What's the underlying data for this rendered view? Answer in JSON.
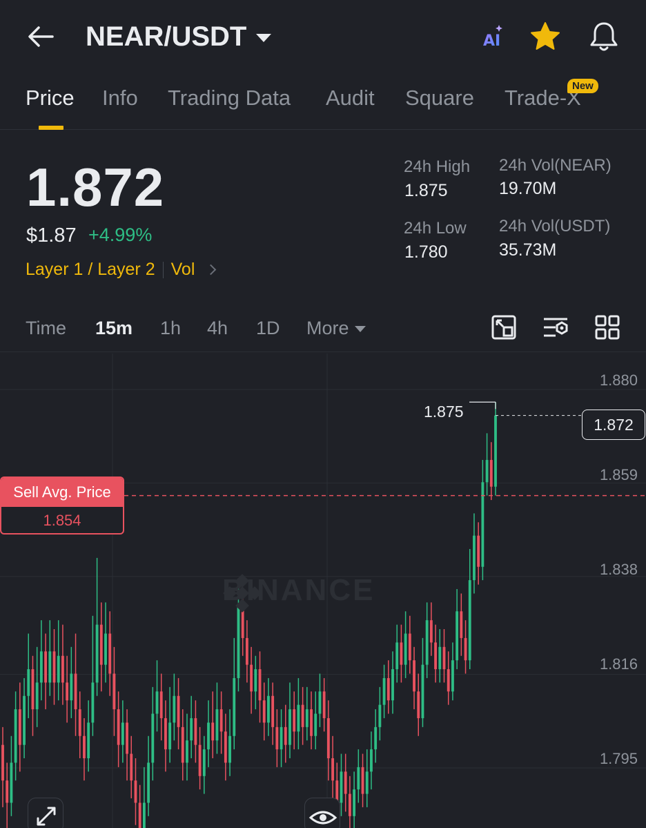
{
  "header": {
    "title": "NEAR/USDT",
    "icons": [
      "back-arrow-icon",
      "ai-icon",
      "star-icon",
      "bell-icon"
    ],
    "star_color": "#f0b90b"
  },
  "tabs": [
    {
      "label": "Price",
      "active": true
    },
    {
      "label": "Info"
    },
    {
      "label": "Trading Data"
    },
    {
      "label": "Audit"
    },
    {
      "label": "Square"
    },
    {
      "label": "Trade-X",
      "badge": "New"
    }
  ],
  "ticker": {
    "last_price": "1.872",
    "usd_price": "$1.87",
    "change_pct": "+4.99%",
    "tag_category": "Layer 1 / Layer 2",
    "tag_vol": "Vol",
    "stats": {
      "high_label": "24h High",
      "high_value": "1.875",
      "low_label": "24h Low",
      "low_value": "1.780",
      "vol_base_label": "24h Vol(NEAR)",
      "vol_base_value": "19.70M",
      "vol_quote_label": "24h Vol(USDT)",
      "vol_quote_value": "35.73M"
    }
  },
  "intervals": {
    "items": [
      "Time",
      "15m",
      "1h",
      "4h",
      "1D",
      "More"
    ],
    "active": "15m",
    "tool_icons": [
      "chart-type-icon",
      "indicator-settings-icon",
      "grid-layout-icon"
    ]
  },
  "chart": {
    "watermark": "BINANCE",
    "axis_labels": [
      "1.880",
      "1.859",
      "1.838",
      "1.816",
      "1.795"
    ],
    "high_marker": "1.875",
    "current_price": "1.872",
    "sell_avg_label": "Sell Avg. Price",
    "sell_avg_value": "1.854",
    "colors": {
      "up": "#2ebd85",
      "down": "#e8525f"
    }
  },
  "chart_data": {
    "type": "candlestick",
    "interval": "15m",
    "y_ticks": [
      1.88,
      1.859,
      1.838,
      1.816,
      1.795
    ],
    "ylim": [
      1.772,
      1.884
    ],
    "candles": [
      [
        1.798,
        1.79,
        1.802,
        1.784
      ],
      [
        1.79,
        1.785,
        1.794,
        1.779
      ],
      [
        1.785,
        1.794,
        1.8,
        1.782
      ],
      [
        1.794,
        1.806,
        1.81,
        1.79
      ],
      [
        1.806,
        1.798,
        1.812,
        1.792
      ],
      [
        1.798,
        1.809,
        1.813,
        1.795
      ],
      [
        1.809,
        1.815,
        1.823,
        1.804
      ],
      [
        1.815,
        1.806,
        1.818,
        1.8
      ],
      [
        1.806,
        1.812,
        1.82,
        1.802
      ],
      [
        1.812,
        1.819,
        1.826,
        1.808
      ],
      [
        1.819,
        1.812,
        1.823,
        1.806
      ],
      [
        1.812,
        1.819,
        1.826,
        1.809
      ],
      [
        1.819,
        1.812,
        1.824,
        1.807
      ],
      [
        1.812,
        1.818,
        1.826,
        1.808
      ],
      [
        1.818,
        1.812,
        1.825,
        1.807
      ],
      [
        1.812,
        1.808,
        1.818,
        1.803
      ],
      [
        1.808,
        1.814,
        1.82,
        1.804
      ],
      [
        1.814,
        1.806,
        1.823,
        1.8
      ],
      [
        1.806,
        1.8,
        1.81,
        1.795
      ],
      [
        1.8,
        1.795,
        1.804,
        1.79
      ],
      [
        1.795,
        1.803,
        1.808,
        1.792
      ],
      [
        1.803,
        1.812,
        1.827,
        1.8
      ],
      [
        1.812,
        1.825,
        1.84,
        1.809
      ],
      [
        1.825,
        1.816,
        1.83,
        1.81
      ],
      [
        1.816,
        1.823,
        1.83,
        1.812
      ],
      [
        1.823,
        1.814,
        1.828,
        1.809
      ],
      [
        1.814,
        1.806,
        1.82,
        1.8
      ],
      [
        1.806,
        1.798,
        1.81,
        1.793
      ],
      [
        1.798,
        1.803,
        1.808,
        1.794
      ],
      [
        1.803,
        1.796,
        1.806,
        1.79
      ],
      [
        1.796,
        1.79,
        1.8,
        1.786
      ],
      [
        1.79,
        1.785,
        1.795,
        1.78
      ],
      [
        1.785,
        1.778,
        1.789,
        1.774
      ],
      [
        1.778,
        1.785,
        1.793,
        1.776
      ],
      [
        1.785,
        1.794,
        1.8,
        1.782
      ],
      [
        1.794,
        1.805,
        1.811,
        1.79
      ],
      [
        1.805,
        1.81,
        1.817,
        1.801
      ],
      [
        1.81,
        1.804,
        1.814,
        1.799
      ],
      [
        1.804,
        1.797,
        1.808,
        1.792
      ],
      [
        1.797,
        1.803,
        1.811,
        1.794
      ],
      [
        1.803,
        1.809,
        1.814,
        1.799
      ],
      [
        1.809,
        1.802,
        1.813,
        1.797
      ],
      [
        1.802,
        1.794,
        1.806,
        1.79
      ],
      [
        1.794,
        1.799,
        1.805,
        1.79
      ],
      [
        1.799,
        1.804,
        1.809,
        1.795
      ],
      [
        1.804,
        1.798,
        1.808,
        1.794
      ],
      [
        1.798,
        1.791,
        1.802,
        1.788
      ],
      [
        1.791,
        1.797,
        1.8,
        1.787
      ],
      [
        1.797,
        1.803,
        1.808,
        1.793
      ],
      [
        1.803,
        1.799,
        1.81,
        1.795
      ],
      [
        1.799,
        1.806,
        1.812,
        1.796
      ],
      [
        1.806,
        1.801,
        1.81,
        1.796
      ],
      [
        1.801,
        1.794,
        1.805,
        1.79
      ],
      [
        1.794,
        1.8,
        1.806,
        1.791
      ],
      [
        1.8,
        1.813,
        1.822,
        1.797
      ],
      [
        1.813,
        1.829,
        1.835,
        1.81
      ],
      [
        1.829,
        1.822,
        1.832,
        1.818
      ],
      [
        1.822,
        1.816,
        1.826,
        1.812
      ],
      [
        1.816,
        1.81,
        1.82,
        1.805
      ],
      [
        1.81,
        1.815,
        1.818,
        1.806
      ],
      [
        1.815,
        1.808,
        1.819,
        1.803
      ],
      [
        1.808,
        1.803,
        1.812,
        1.799
      ],
      [
        1.803,
        1.809,
        1.813,
        1.8
      ],
      [
        1.809,
        1.802,
        1.812,
        1.798
      ],
      [
        1.802,
        1.797,
        1.806,
        1.793
      ],
      [
        1.797,
        1.802,
        1.806,
        1.793
      ],
      [
        1.802,
        1.798,
        1.807,
        1.794
      ],
      [
        1.798,
        1.806,
        1.812,
        1.795
      ],
      [
        1.806,
        1.801,
        1.81,
        1.797
      ],
      [
        1.801,
        1.807,
        1.813,
        1.797
      ],
      [
        1.807,
        1.802,
        1.811,
        1.798
      ],
      [
        1.802,
        1.806,
        1.811,
        1.799
      ],
      [
        1.806,
        1.8,
        1.81,
        1.797
      ],
      [
        1.8,
        1.805,
        1.81,
        1.797
      ],
      [
        1.805,
        1.81,
        1.814,
        1.802
      ],
      [
        1.81,
        1.804,
        1.813,
        1.801
      ],
      [
        1.804,
        1.795,
        1.808,
        1.79
      ],
      [
        1.795,
        1.79,
        1.8,
        1.785
      ],
      [
        1.79,
        1.785,
        1.794,
        1.78
      ],
      [
        1.785,
        1.792,
        1.796,
        1.782
      ],
      [
        1.792,
        1.787,
        1.796,
        1.783
      ],
      [
        1.787,
        1.782,
        1.791,
        1.778
      ],
      [
        1.782,
        1.788,
        1.792,
        1.779
      ],
      [
        1.788,
        1.793,
        1.797,
        1.785
      ],
      [
        1.793,
        1.787,
        1.796,
        1.784
      ],
      [
        1.787,
        1.792,
        1.797,
        1.784
      ],
      [
        1.792,
        1.797,
        1.801,
        1.788
      ],
      [
        1.797,
        1.802,
        1.806,
        1.794
      ],
      [
        1.802,
        1.807,
        1.811,
        1.799
      ],
      [
        1.807,
        1.813,
        1.816,
        1.804
      ],
      [
        1.813,
        1.808,
        1.817,
        1.805
      ],
      [
        1.808,
        1.815,
        1.819,
        1.805
      ],
      [
        1.815,
        1.821,
        1.825,
        1.812
      ],
      [
        1.821,
        1.816,
        1.825,
        1.812
      ],
      [
        1.816,
        1.823,
        1.828,
        1.813
      ],
      [
        1.823,
        1.817,
        1.827,
        1.814
      ],
      [
        1.817,
        1.81,
        1.82,
        1.806
      ],
      [
        1.81,
        1.804,
        1.814,
        1.8
      ],
      [
        1.804,
        1.816,
        1.822,
        1.802
      ],
      [
        1.816,
        1.826,
        1.83,
        1.813
      ],
      [
        1.826,
        1.821,
        1.83,
        1.818
      ],
      [
        1.821,
        1.815,
        1.825,
        1.812
      ],
      [
        1.815,
        1.82,
        1.824,
        1.812
      ],
      [
        1.82,
        1.815,
        1.824,
        1.812
      ],
      [
        1.815,
        1.81,
        1.819,
        1.807
      ],
      [
        1.81,
        1.817,
        1.821,
        1.808
      ],
      [
        1.817,
        1.828,
        1.833,
        1.815
      ],
      [
        1.828,
        1.822,
        1.832,
        1.818
      ],
      [
        1.822,
        1.817,
        1.826,
        1.814
      ],
      [
        1.817,
        1.835,
        1.842,
        1.815
      ],
      [
        1.835,
        1.845,
        1.85,
        1.832
      ],
      [
        1.845,
        1.838,
        1.848,
        1.834
      ],
      [
        1.838,
        1.857,
        1.862,
        1.835
      ],
      [
        1.857,
        1.862,
        1.868,
        1.854
      ],
      [
        1.862,
        1.856,
        1.866,
        1.853
      ],
      [
        1.856,
        1.872,
        1.875,
        1.854
      ]
    ],
    "annotations": {
      "high": 1.875,
      "current": 1.872,
      "sell_avg_price": 1.854
    }
  }
}
